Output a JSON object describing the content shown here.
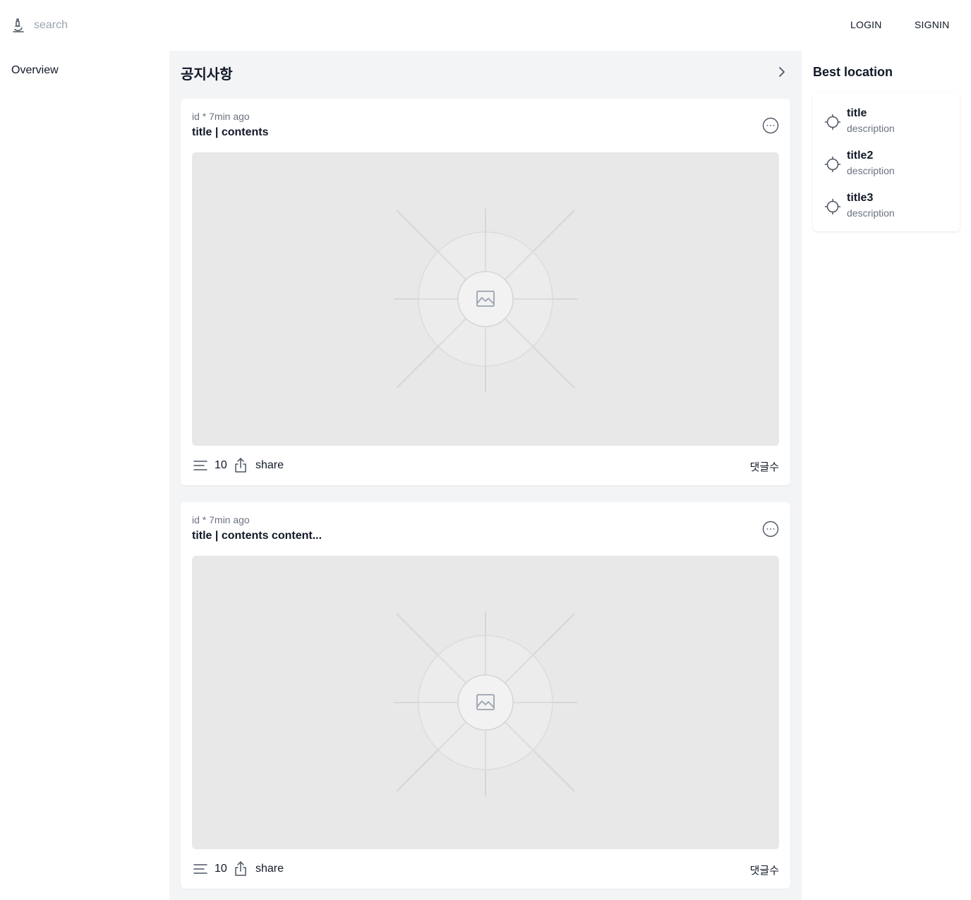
{
  "header": {
    "search_placeholder": "search",
    "login_label": "LOGIN",
    "signin_label": "SIGNIN"
  },
  "sidebar": {
    "items": [
      {
        "label": "Overview"
      }
    ]
  },
  "main": {
    "section_title": "공지사항",
    "posts": [
      {
        "meta": "id * 7min ago",
        "title": "title | contents",
        "count": "10",
        "share_label": "share",
        "comments_label": "댓글수"
      },
      {
        "meta": "id * 7min ago",
        "title": "title | contents content...",
        "count": "10",
        "share_label": "share",
        "comments_label": "댓글수"
      }
    ]
  },
  "best_location": {
    "title": "Best location",
    "items": [
      {
        "title": "title",
        "description": "description"
      },
      {
        "title": "title2",
        "description": "description"
      },
      {
        "title": "title3",
        "description": "description"
      }
    ]
  },
  "icons": {
    "logo": "microscope-icon",
    "chevron": "chevron-right-icon",
    "more": "more-horizontal-circle-icon",
    "menu": "menu-lines-icon",
    "share": "share-upload-icon",
    "location": "crosshair-icon",
    "image_placeholder": "image-placeholder-icon"
  },
  "colors": {
    "feed_background": "#f3f4f6",
    "image_placeholder": "#e8e8e8",
    "muted_text": "#6b7280"
  }
}
